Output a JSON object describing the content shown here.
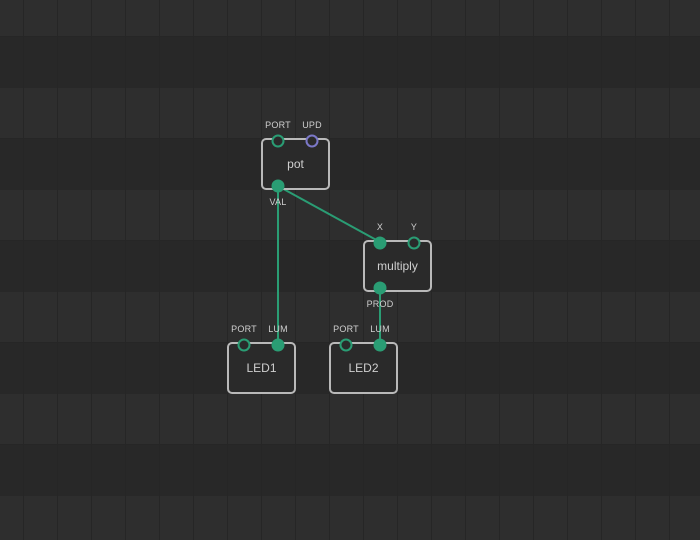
{
  "colors": {
    "background": "#2e2e2e",
    "node_border": "#b9b9b9",
    "pin_value": "#2a9d74",
    "pin_pulse": "#7b78c8",
    "link": "#2a9d74",
    "text": "#cfcfcf"
  },
  "nodes": {
    "pot": {
      "label": "pot",
      "inputs": [
        {
          "label": "PORT",
          "type": "value"
        },
        {
          "label": "UPD",
          "type": "pulse"
        }
      ],
      "outputs": [
        {
          "label": "VAL",
          "type": "value"
        }
      ]
    },
    "multiply": {
      "label": "multiply",
      "inputs": [
        {
          "label": "X",
          "type": "value"
        },
        {
          "label": "Y",
          "type": "value"
        }
      ],
      "outputs": [
        {
          "label": "PROD",
          "type": "value"
        }
      ]
    },
    "led1": {
      "label": "LED1",
      "inputs": [
        {
          "label": "PORT",
          "type": "value"
        },
        {
          "label": "LUM",
          "type": "value"
        }
      ]
    },
    "led2": {
      "label": "LED2",
      "inputs": [
        {
          "label": "PORT",
          "type": "value"
        },
        {
          "label": "LUM",
          "type": "value"
        }
      ]
    }
  },
  "links": [
    {
      "from": "pot.VAL",
      "to": "multiply.X"
    },
    {
      "from": "pot.VAL",
      "to": "led1.LUM"
    },
    {
      "from": "multiply.PROD",
      "to": "led2.LUM"
    }
  ]
}
